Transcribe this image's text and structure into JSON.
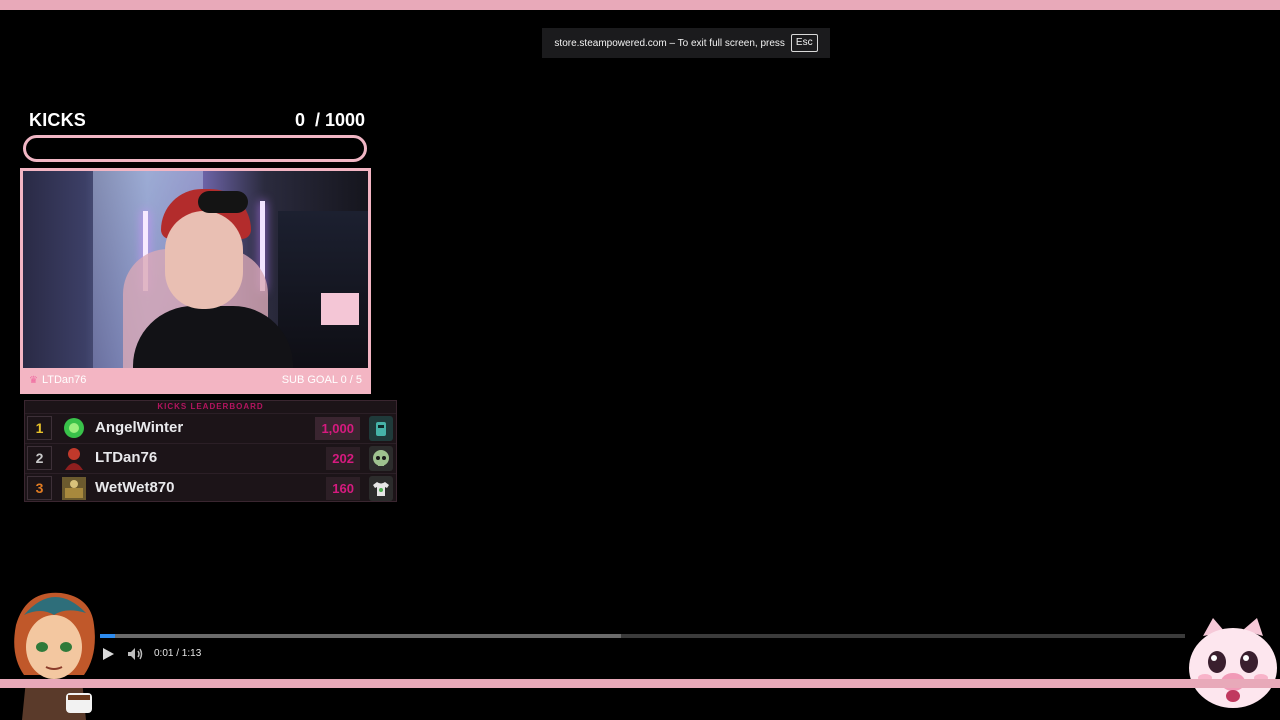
{
  "browser": {
    "fullscreen_notice_text": "store.steampowered.com – To exit full screen, press",
    "esc_key": "Esc"
  },
  "kicks_goal": {
    "label": "KICKS",
    "current": "0",
    "target": "1000",
    "count_text": "0  / 1000",
    "progress_fraction": 0,
    "accent_color": "#f06aa0",
    "border_color": "#f0b6c4"
  },
  "webcam": {
    "channel_name": "LTDan76",
    "sub_goal_text": "SUB GOAL 0 / 5",
    "frame_color": "#f3b5c3"
  },
  "leaderboard": {
    "title": "KICKS LEADERBOARD",
    "rows": [
      {
        "rank": "1",
        "name": "AngelWinter",
        "amount": "1,000",
        "rank_color": "#e8c229",
        "avatar_icon": "green-orb-avatar-icon",
        "badge_icon": "robot-badge-icon"
      },
      {
        "rank": "2",
        "name": "LTDan76",
        "amount": "202",
        "rank_color": "#c9c9c9",
        "avatar_icon": "red-figure-avatar-icon",
        "badge_icon": "skull-badge-icon"
      },
      {
        "rank": "3",
        "name": "WetWet870",
        "amount": "160",
        "rank_color": "#e07b22",
        "avatar_icon": "game-cover-avatar-icon",
        "badge_icon": "tshirt-badge-icon"
      }
    ]
  },
  "video_player": {
    "time_text": "0:01 / 1:13",
    "played_fraction": 0.014,
    "buffered_fraction": 0.48,
    "progress_color": "#2d8cf0"
  }
}
